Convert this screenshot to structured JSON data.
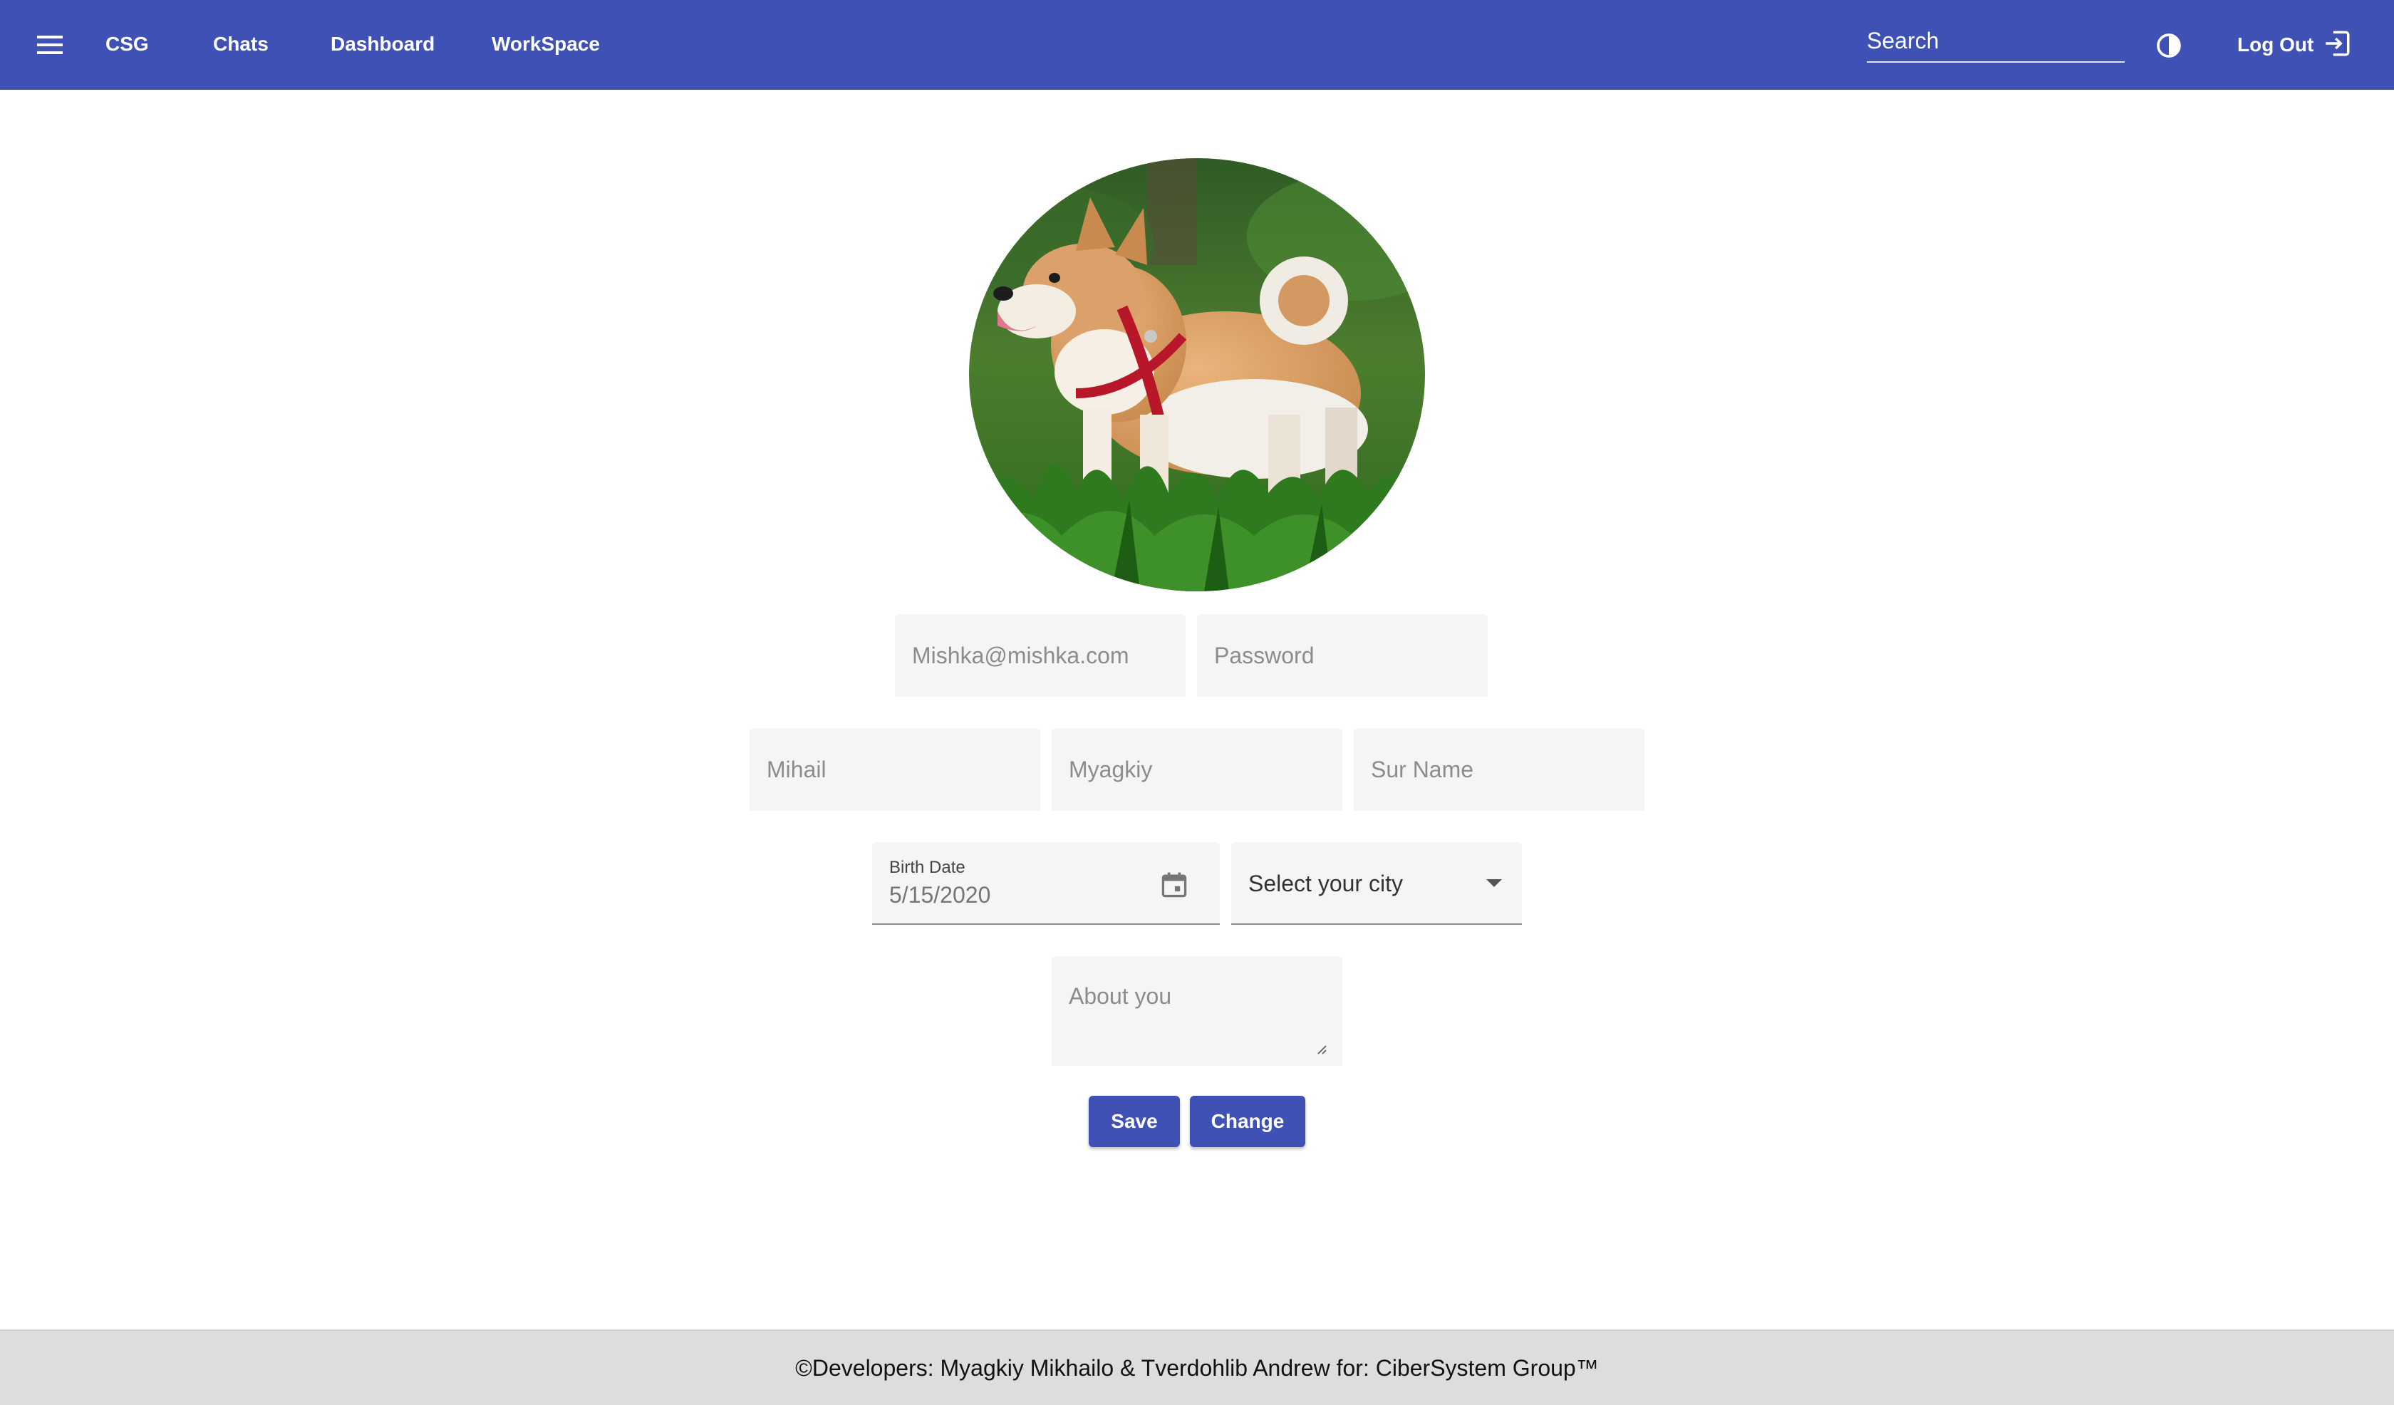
{
  "header": {
    "menu_icon": "menu-icon",
    "nav": [
      {
        "label": "CSG"
      },
      {
        "label": "Chats"
      },
      {
        "label": "Dashboard"
      },
      {
        "label": "WorkSpace"
      }
    ],
    "search": {
      "placeholder": "Search",
      "value": ""
    },
    "theme_icon": "contrast-icon",
    "logout": {
      "label": "Log Out",
      "icon": "logout-icon"
    },
    "background_color": "#3f51b5"
  },
  "profile": {
    "avatar": {
      "subject": "shiba-inu-dog-photo"
    },
    "email": {
      "value": "",
      "placeholder": "Mishka@mishka.com"
    },
    "password": {
      "value": "",
      "placeholder": "Password"
    },
    "first_name": {
      "value": "",
      "placeholder": "Mihail"
    },
    "last_name": {
      "value": "",
      "placeholder": "Myagkiy"
    },
    "sur_name": {
      "value": "",
      "placeholder": "Sur Name"
    },
    "birth_date": {
      "label": "Birth Date",
      "placeholder": "5/15/2020",
      "icon": "calendar-icon"
    },
    "city": {
      "selected": "Select your city",
      "icon": "dropdown-arrow-icon"
    },
    "about": {
      "value": "",
      "placeholder": "About you"
    },
    "buttons": {
      "save": "Save",
      "change": "Change"
    },
    "accent_color": "#3f51b5"
  },
  "footer": {
    "text": "©Developers: Myagkiy Mikhailo & Tverdohlib Andrew for: CiberSystem Group™"
  }
}
